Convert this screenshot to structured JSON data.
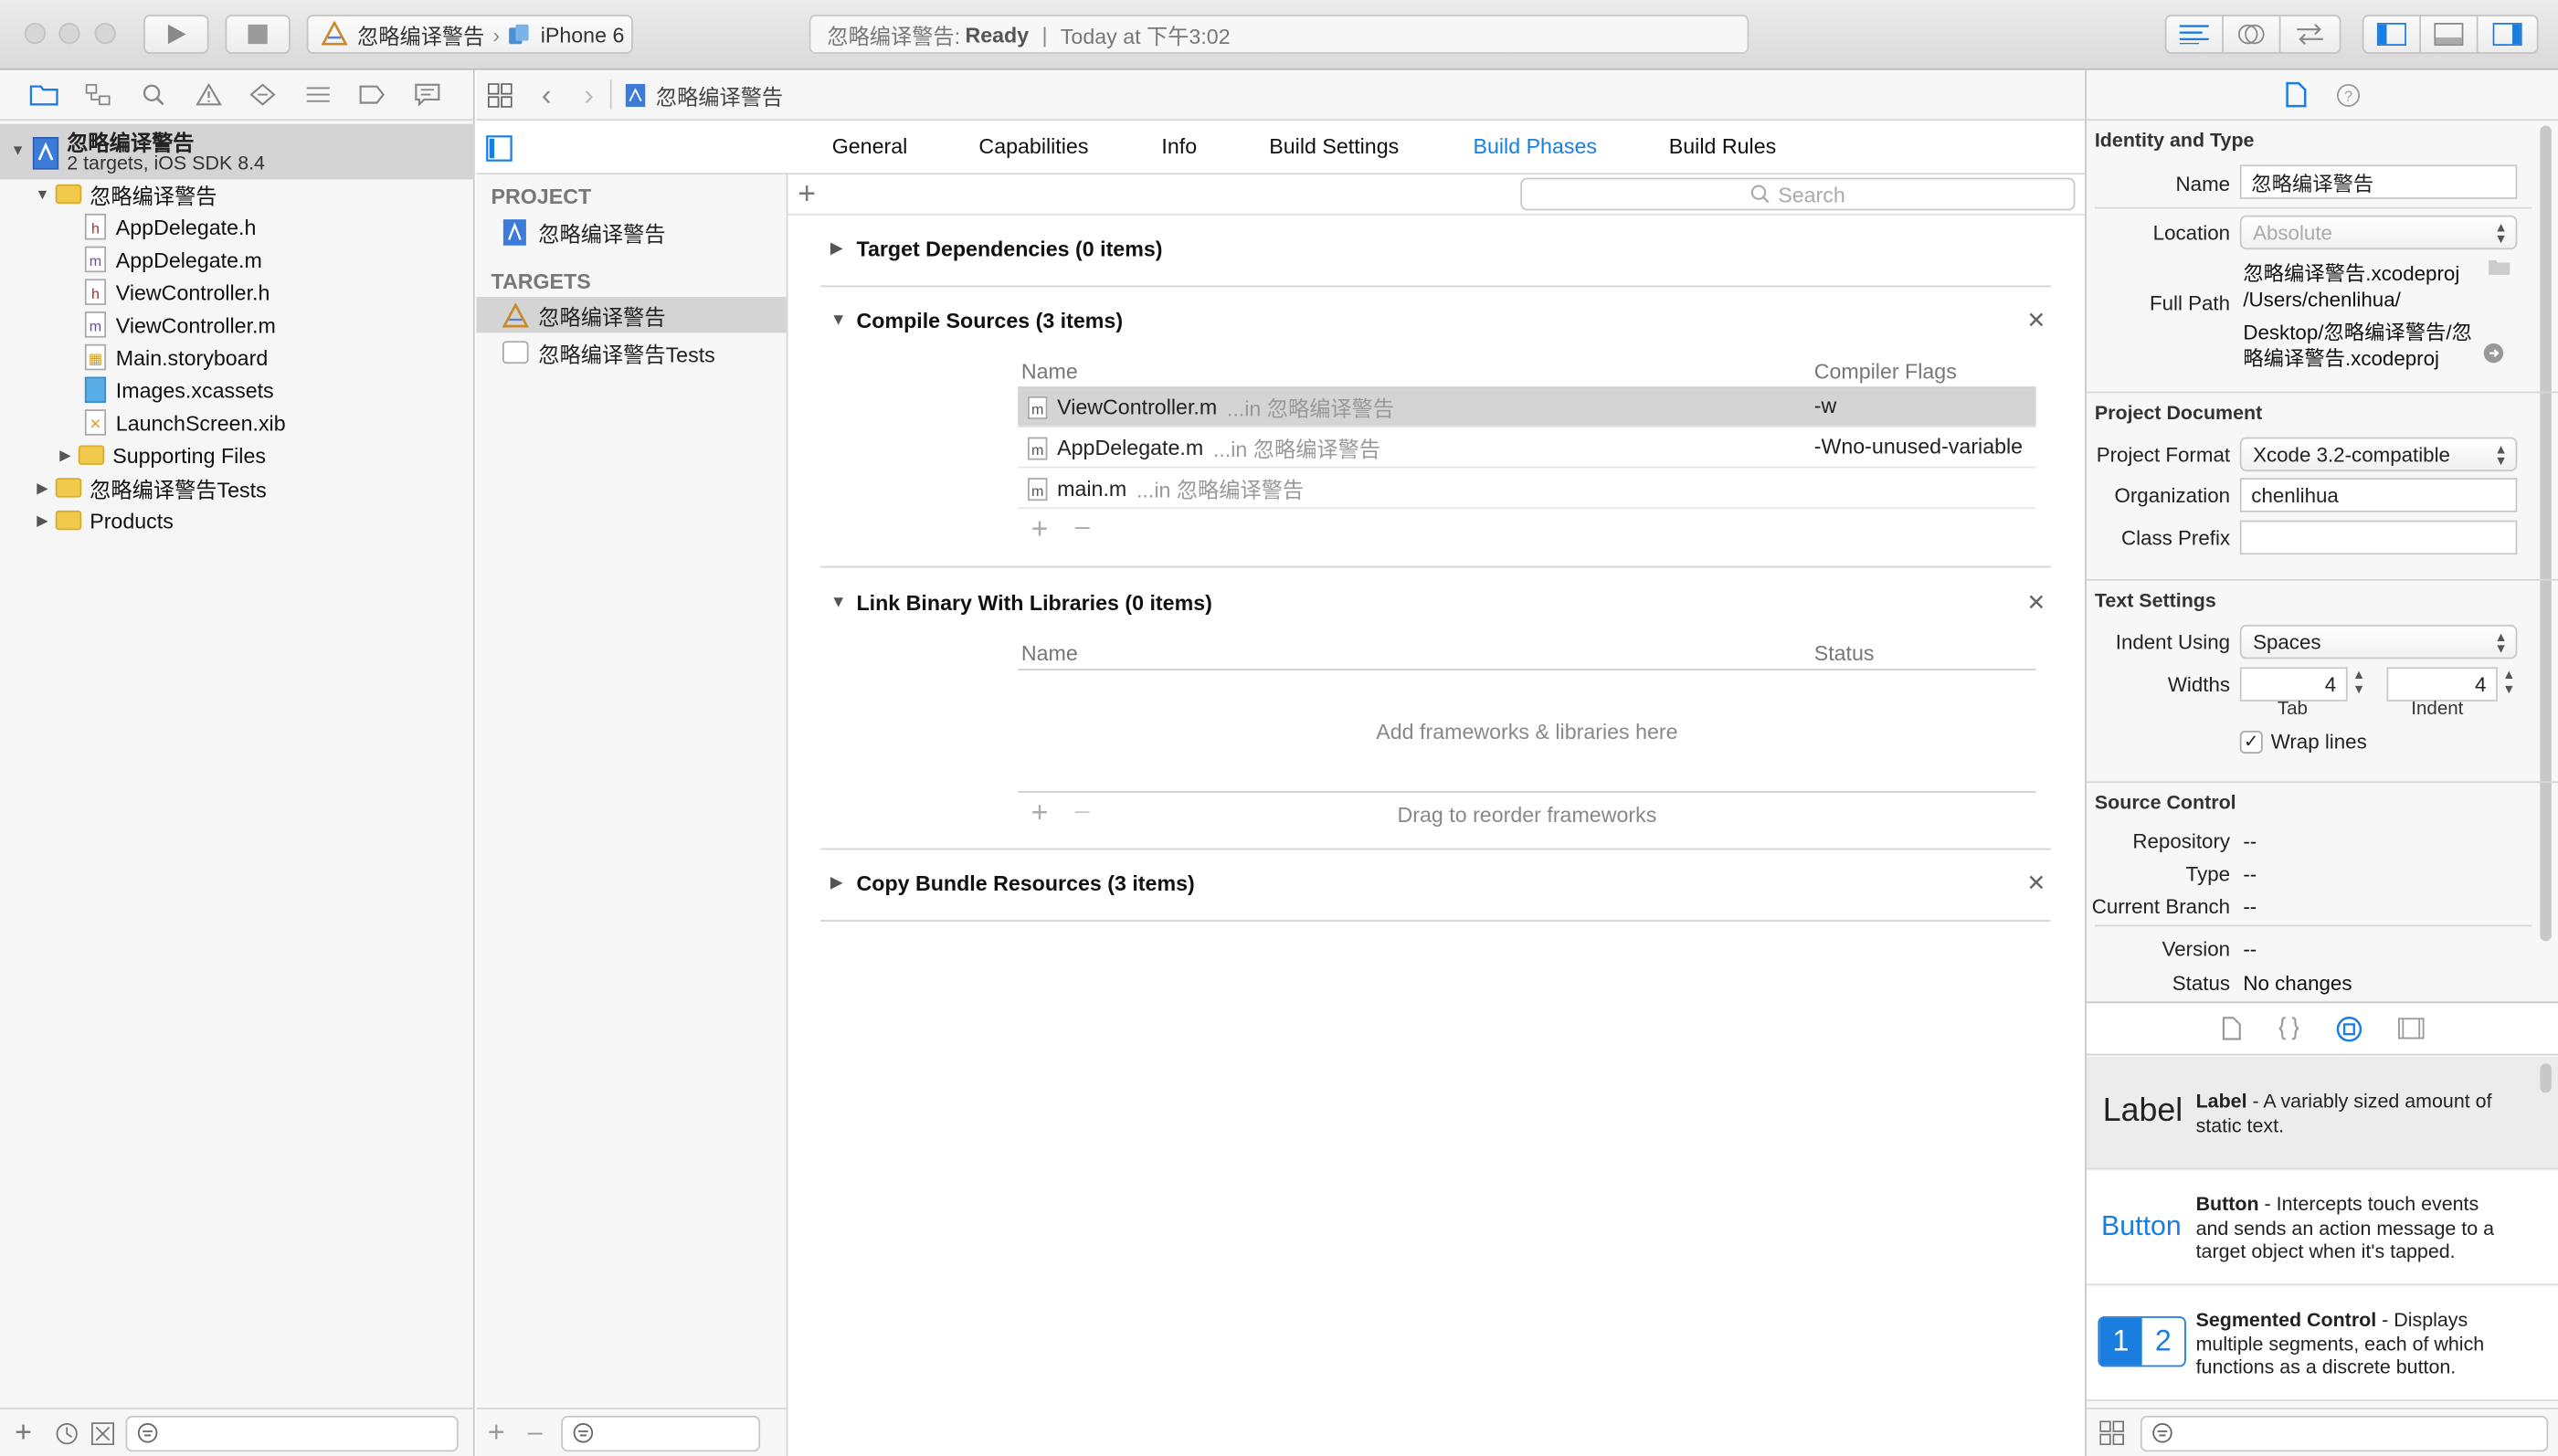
{
  "toolbar": {
    "scheme_name": "忽略编译警告",
    "device": "iPhone 6",
    "activity_project": "忽略编译警告: ",
    "activity_status": "Ready",
    "activity_sep": "|",
    "activity_time": "Today at 下午3:02"
  },
  "navigator": {
    "project_name": "忽略编译警告",
    "project_subtitle": "2 targets, iOS SDK 8.4",
    "items": [
      {
        "label": "忽略编译警告",
        "kind": "folder",
        "disclosure": "open"
      },
      {
        "label": "AppDelegate.h",
        "kind": "h"
      },
      {
        "label": "AppDelegate.m",
        "kind": "m"
      },
      {
        "label": "ViewController.h",
        "kind": "h"
      },
      {
        "label": "ViewController.m",
        "kind": "m"
      },
      {
        "label": "Main.storyboard",
        "kind": "storyboard"
      },
      {
        "label": "Images.xcassets",
        "kind": "assets"
      },
      {
        "label": "LaunchScreen.xib",
        "kind": "xib"
      },
      {
        "label": "Supporting Files",
        "kind": "folder",
        "disclosure": "closed"
      },
      {
        "label": "忽略编译警告Tests",
        "kind": "folder",
        "disclosure": "closed"
      },
      {
        "label": "Products",
        "kind": "folder",
        "disclosure": "closed"
      }
    ]
  },
  "editor": {
    "breadcrumb": "忽略编译警告",
    "tabs": [
      "General",
      "Capabilities",
      "Info",
      "Build Settings",
      "Build Phases",
      "Build Rules"
    ],
    "active_tab": "Build Phases",
    "search_placeholder": "Search",
    "project_header": "PROJECT",
    "project_item": "忽略编译警告",
    "targets_header": "TARGETS",
    "targets": [
      "忽略编译警告",
      "忽略编译警告Tests"
    ],
    "phases": {
      "target_deps": "Target Dependencies (0 items)",
      "compile": {
        "title": "Compile Sources (3 items)",
        "col_name": "Name",
        "col_flags": "Compiler Flags",
        "rows": [
          {
            "file": "ViewController.m",
            "loc": "...in 忽略编译警告",
            "flags": "-w"
          },
          {
            "file": "AppDelegate.m",
            "loc": "...in 忽略编译警告",
            "flags": "-Wno-unused-variable"
          },
          {
            "file": "main.m",
            "loc": "...in 忽略编译警告",
            "flags": ""
          }
        ]
      },
      "link": {
        "title": "Link Binary With Libraries (0 items)",
        "col_name": "Name",
        "col_status": "Status",
        "empty": "Add frameworks & libraries here",
        "hint": "Drag to reorder frameworks"
      },
      "copy": "Copy Bundle Resources (3 items)"
    }
  },
  "inspector": {
    "identity": {
      "header": "Identity and Type",
      "name_label": "Name",
      "name_value": "忽略编译警告",
      "location_label": "Location",
      "location_value": "Absolute",
      "file_name": "忽略编译警告.xcodeproj",
      "full_path_label": "Full Path",
      "full_path_1": "/Users/chenlihua/",
      "full_path_2": "Desktop/忽略编译警告/忽",
      "full_path_3": "略编译警告.xcodeproj"
    },
    "project_doc": {
      "header": "Project Document",
      "format_label": "Project Format",
      "format_value": "Xcode 3.2-compatible",
      "org_label": "Organization",
      "org_value": "chenlihua",
      "prefix_label": "Class Prefix",
      "prefix_value": ""
    },
    "text_settings": {
      "header": "Text Settings",
      "indent_label": "Indent Using",
      "indent_value": "Spaces",
      "widths_label": "Widths",
      "tab_value": "4",
      "indent_width_value": "4",
      "tab_caption": "Tab",
      "indent_caption": "Indent",
      "wrap_label": "Wrap lines",
      "wrap_checked": true
    },
    "source_control": {
      "header": "Source Control",
      "repo_label": "Repository",
      "repo_value": "--",
      "type_label": "Type",
      "type_value": "--",
      "branch_label": "Current Branch",
      "branch_value": "--",
      "version_label": "Version",
      "version_value": "--",
      "status_label": "Status",
      "status_value": "No changes"
    },
    "library": [
      {
        "preview": "Label",
        "title": "Label",
        "desc": " - A variably sized amount of static text."
      },
      {
        "preview": "Button",
        "title": "Button",
        "desc": " - Intercepts touch events and sends an action message to a target object when it's tapped."
      },
      {
        "preview_1": "1",
        "preview_2": "2",
        "title": "Segmented Control",
        "desc": " - Displays multiple segments, each of which functions as a discrete button."
      }
    ]
  },
  "colors": {
    "accent": "#1a7ee0",
    "selection": "#d4d4d4"
  }
}
